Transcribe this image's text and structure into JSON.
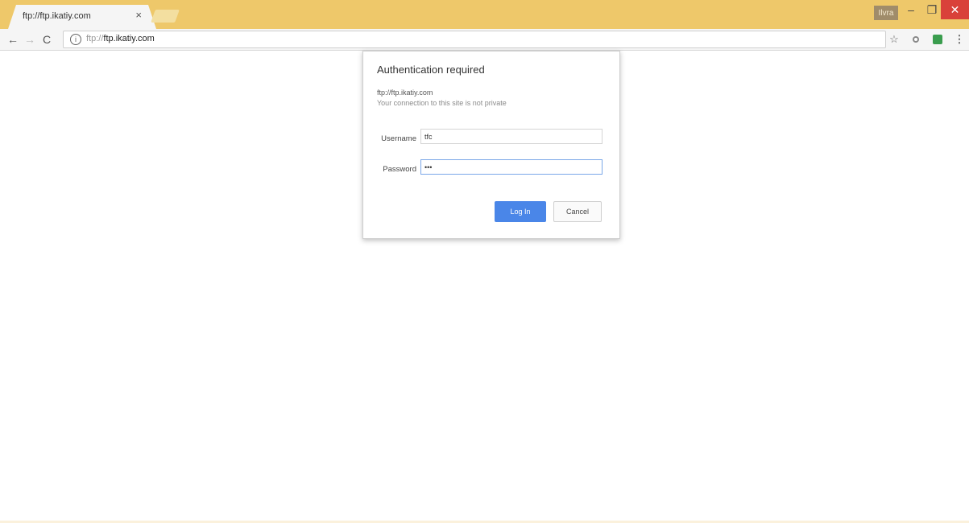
{
  "browser": {
    "tab_title": "ftp://ftp.ikatiy.com",
    "tab_close_glyph": "×",
    "profile_label": "Ilvra",
    "window_controls": {
      "minimize": "–",
      "maximize": "❐",
      "close": "✕"
    },
    "accent_colors": {
      "titlebar": "#eec86a",
      "close": "#d9413a",
      "login": "#4a86e8"
    }
  },
  "toolbar": {
    "back_icon": "←",
    "forward_icon": "→",
    "reload_icon": "C",
    "info_icon": "i",
    "url_scheme": "ftp://",
    "url_host": "ftp.ikatiy.com",
    "star_icon": "☆",
    "menu_icon": "⋮"
  },
  "dialog": {
    "title": "Authentication required",
    "origin": "ftp://ftp.ikatiy.com",
    "warning": "Your connection to this site is not private",
    "username_label": "Username",
    "username_value": "tfc",
    "password_label": "Password",
    "password_value": "•••",
    "login_label": "Log In",
    "cancel_label": "Cancel"
  }
}
